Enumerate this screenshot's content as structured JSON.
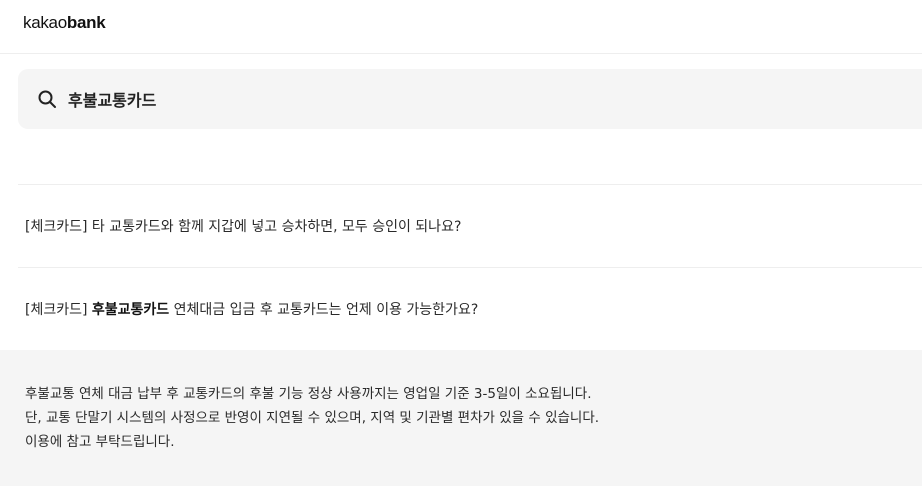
{
  "header": {
    "logo_light": "kakao",
    "logo_bold": "bank"
  },
  "search": {
    "value": "후불교통카드",
    "icon": "search-icon"
  },
  "faq": [
    {
      "prefix": "[체크카드] 타 교통카드와 함께 지갑에 넣고 승차하면, 모두 승인이 되나요?",
      "highlight": "",
      "suffix": ""
    },
    {
      "prefix": "[체크카드] ",
      "highlight": "후불교통카드",
      "suffix": " 연체대금 입금 후 교통카드는 언제 이용 가능한가요?"
    }
  ],
  "answer": {
    "lines": [
      "후불교통 연체 대금 납부 후 교통카드의 후불 기능 정상 사용까지는 영업일 기준 3-5일이 소요됩니다.",
      "단, 교통 단말기 시스템의 사정으로 반영이 지연될 수 있으며, 지역 및 기관별 편차가 있을 수 있습니다.",
      "이용에 참고 부탁드립니다."
    ]
  }
}
